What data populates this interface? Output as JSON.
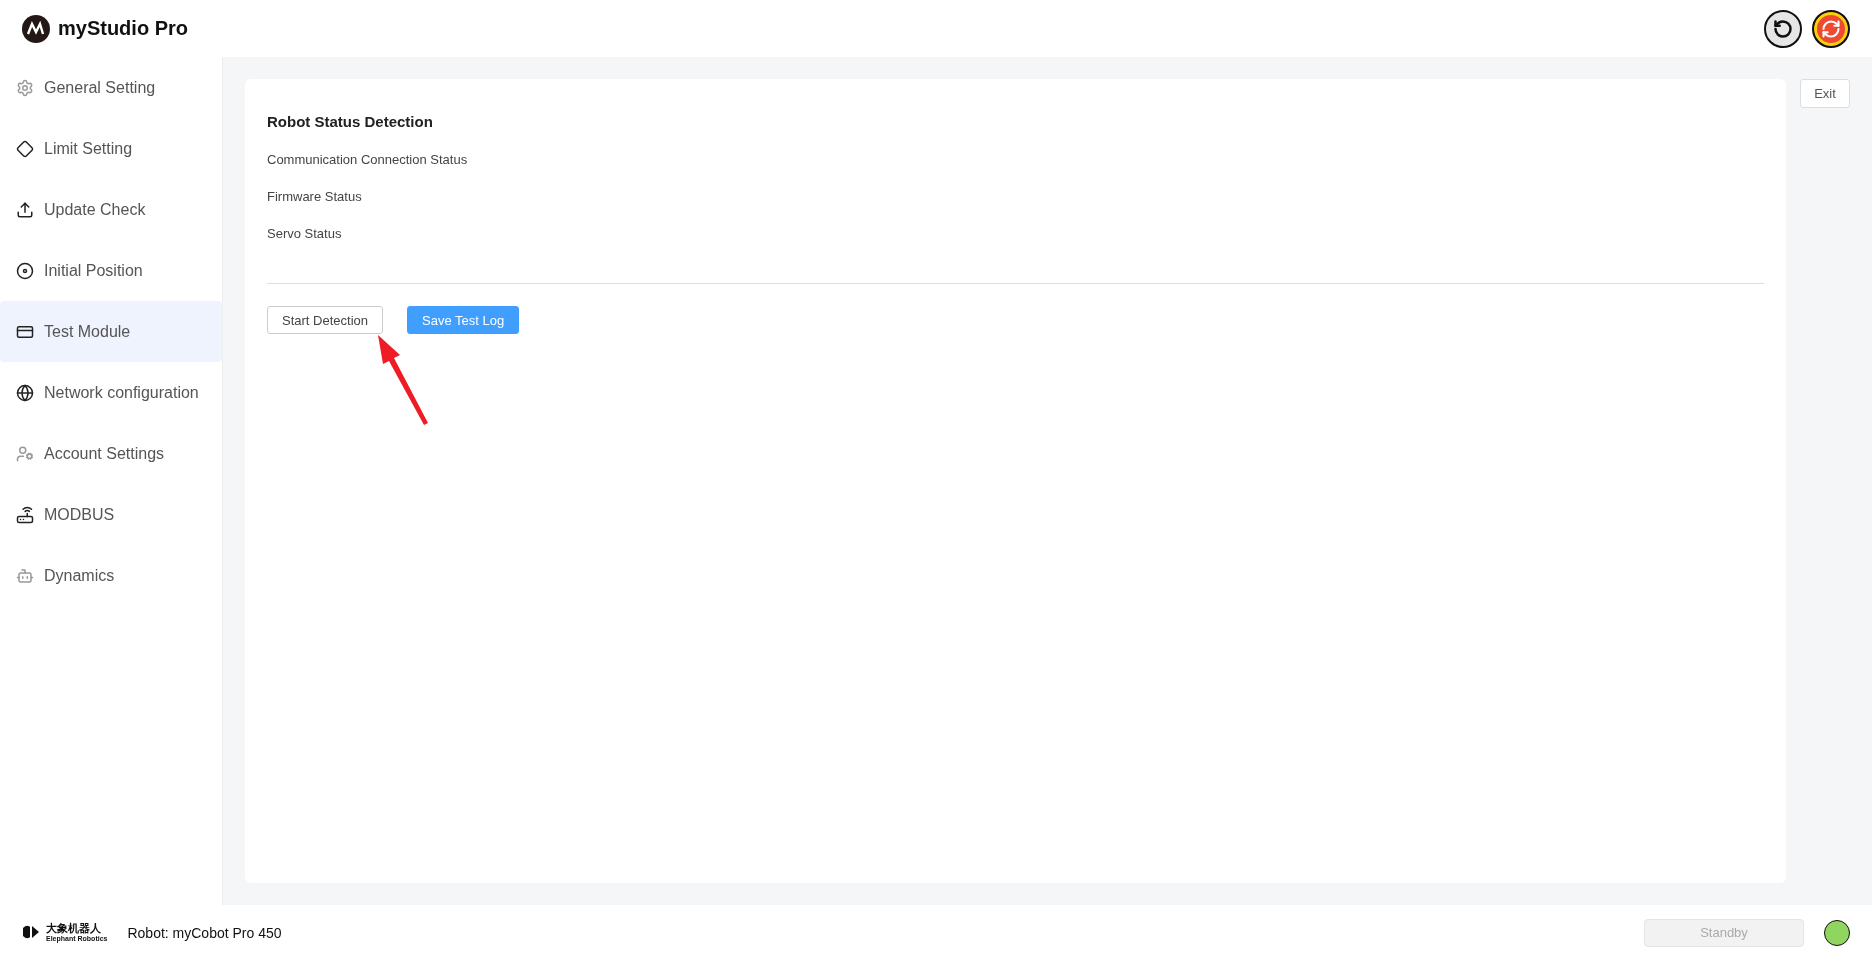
{
  "app": {
    "title": "myStudio Pro"
  },
  "sidebar": {
    "items": [
      {
        "label": "General Setting",
        "selected": false
      },
      {
        "label": "Limit Setting",
        "selected": false
      },
      {
        "label": "Update Check",
        "selected": false
      },
      {
        "label": "Initial Position",
        "selected": false
      },
      {
        "label": "Test Module",
        "selected": true
      },
      {
        "label": "Network configuration",
        "selected": false
      },
      {
        "label": "Account Settings",
        "selected": false
      },
      {
        "label": "MODBUS",
        "selected": false
      },
      {
        "label": "Dynamics",
        "selected": false
      }
    ]
  },
  "panel": {
    "title": "Robot Status Detection",
    "statuses": [
      "Communication Connection Status",
      "Firmware Status",
      "Servo Status"
    ],
    "buttons": [
      {
        "label": "Start Detection",
        "kind": "default"
      },
      {
        "label": "Save Test Log",
        "kind": "primary"
      }
    ]
  },
  "exit_button": "Exit",
  "footer": {
    "brand_cn": "大象机器人",
    "brand_en": "Elephant Robotics",
    "robot": "Robot: myCobot Pro 450",
    "mode_button": {
      "label": "Standby",
      "disabled": true
    },
    "status_light": {
      "color": "#91d561"
    }
  }
}
